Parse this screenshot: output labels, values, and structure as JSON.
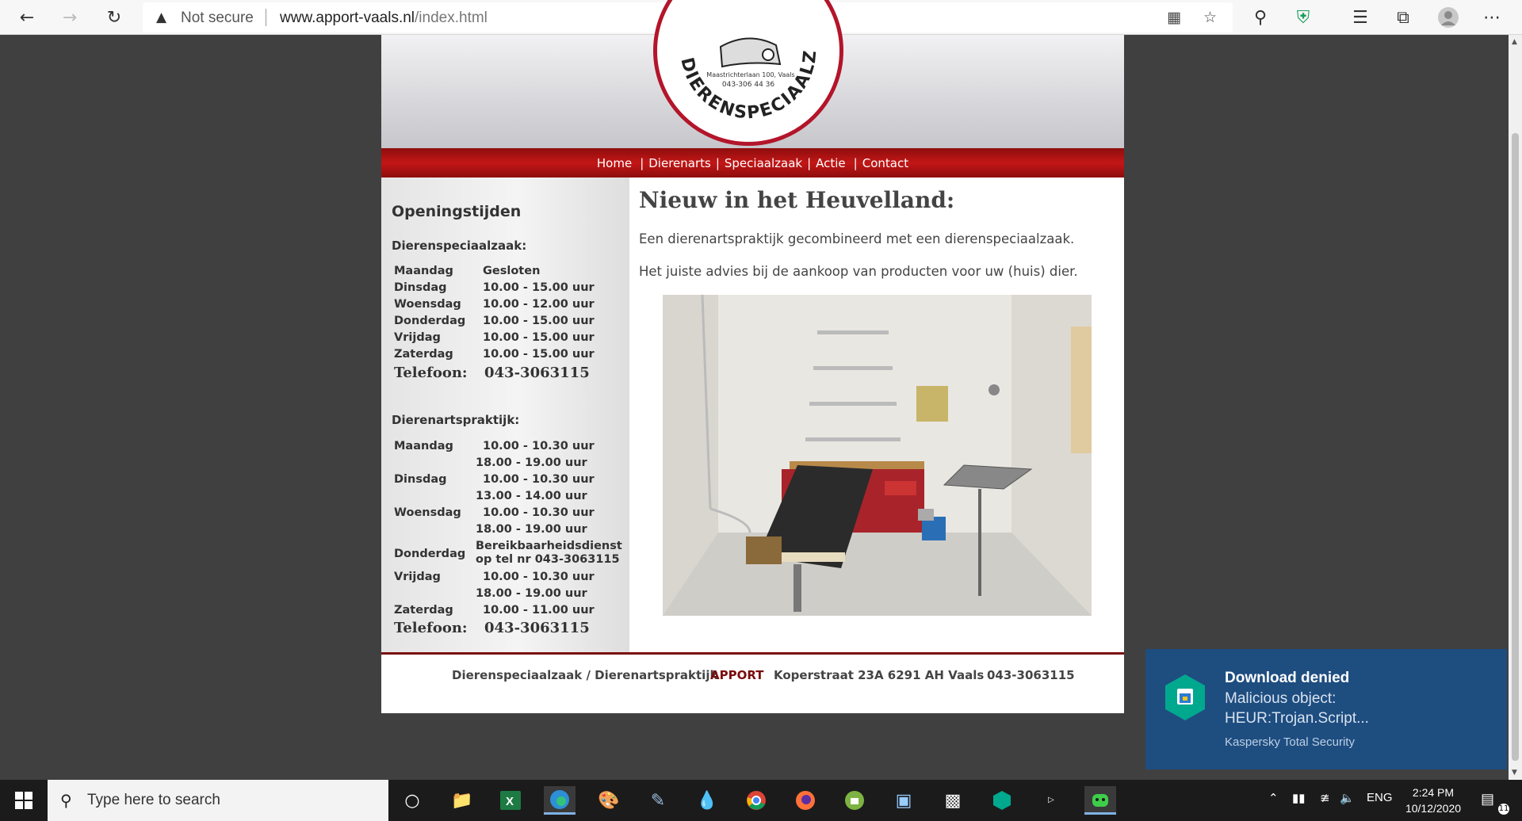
{
  "browser": {
    "security_label": "Not secure",
    "url_host": "www.apport-vaals.nl",
    "url_path": "/index.html"
  },
  "site": {
    "logo_address": "Maastrichterlaan 100, Vaals",
    "logo_phone": "043-306 44 36",
    "logo_ring_text": "DIERENSPECIAALZAAK",
    "nav": [
      "Home",
      "Dierenarts",
      "Speciaalzaak",
      "Actie",
      "Contact"
    ],
    "sidebar": {
      "title": "Openingstijden",
      "shop_heading": "Dierenspeciaalzaak:",
      "shop_hours": [
        {
          "day": "Maandag",
          "time": "Gesloten"
        },
        {
          "day": "Dinsdag",
          "time": "10.00  -  15.00 uur"
        },
        {
          "day": "Woensdag",
          "time": "10.00  -  12.00 uur"
        },
        {
          "day": "Donderdag",
          "time": "10.00  -  15.00 uur"
        },
        {
          "day": "Vrijdag",
          "time": "10.00  -  15.00 uur"
        },
        {
          "day": "Zaterdag",
          "time": "10.00  -  15.00 uur"
        }
      ],
      "phone_label": "Telefoon:",
      "phone": "043-3063115",
      "vet_heading": "Dierenartspraktijk:",
      "vet_hours": {
        "maandag": {
          "day": "Maandag",
          "t1": "10.00  -  10.30 uur",
          "t2": "18.00  -  19.00 uur"
        },
        "dinsdag": {
          "day": "Dinsdag",
          "t1": "10.00  -  10.30 uur",
          "t2": "13.00  -  14.00 uur"
        },
        "woensdag": {
          "day": "Woensdag",
          "t1": "10.00  -  10.30 uur",
          "t2": "18.00  -  19.00 uur"
        },
        "donderdag": {
          "day": "Donderdag",
          "t1": "Bereikbaarheidsdienst",
          "t2": "op tel nr 043-3063115"
        },
        "vrijdag": {
          "day": "Vrijdag",
          "t1": "10.00  -  10.30 uur",
          "t2": "18.00  -  19.00 uur"
        },
        "zaterdag": {
          "day": "Zaterdag",
          "t1": "10.00  -  11.00 uur"
        }
      }
    },
    "content": {
      "heading": "Nieuw in het Heuvelland:",
      "p1": "Een dierenartspraktijk gecombineerd met een dierenspeciaalzaak.",
      "p2": "Het juiste advies bij de aankoop van producten voor uw (huis) dier."
    },
    "footer": {
      "desc": "Dierenspeciaalzaak / Dierenartspraktijk",
      "brand": "APPORT",
      "address": "Koperstraat 23A 6291 AH Vaals",
      "phone": "043-3063115"
    }
  },
  "toast": {
    "title": "Download denied",
    "line1": "Malicious object:",
    "line2": "HEUR:Trojan.Script...",
    "source": "Kaspersky Total Security"
  },
  "taskbar": {
    "search_placeholder": "Type here to search",
    "lang": "ENG",
    "time": "2:24 PM",
    "date": "10/12/2020",
    "notification_count": "11"
  },
  "colors": {
    "nav_red": "#b31414",
    "toast_blue": "#1e4d80",
    "desktop_bg": "#404040"
  }
}
